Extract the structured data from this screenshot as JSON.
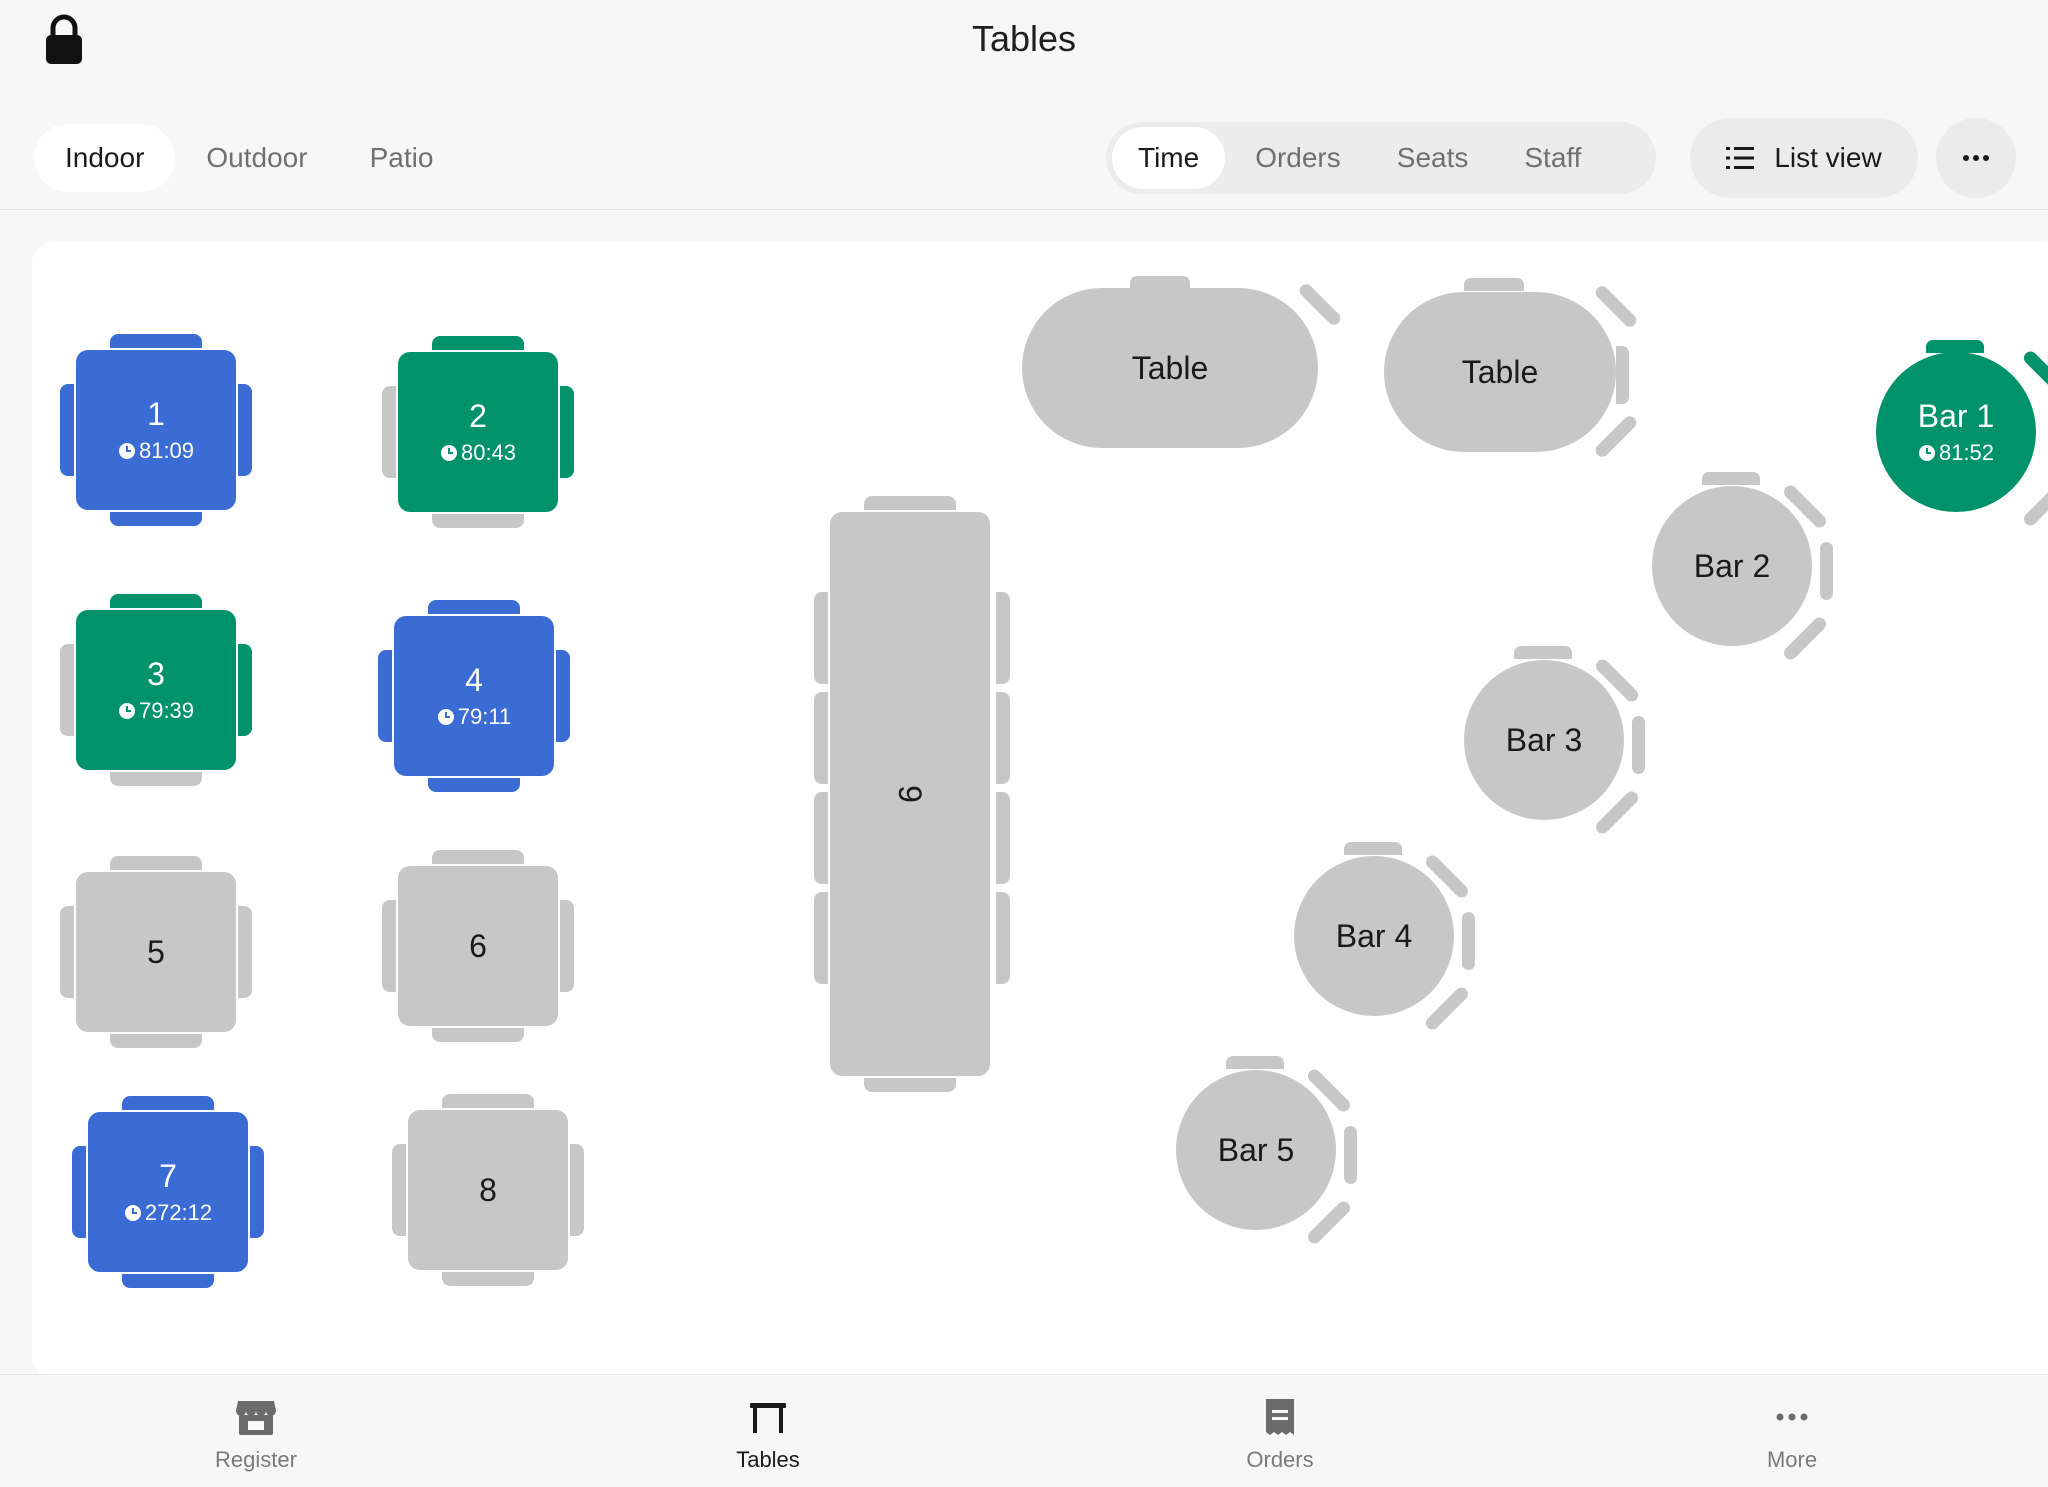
{
  "header": {
    "title": "Tables"
  },
  "area_tabs": [
    "Indoor",
    "Outdoor",
    "Patio"
  ],
  "active_area": "Indoor",
  "view_segments": [
    "Time",
    "Orders",
    "Seats",
    "Staff"
  ],
  "active_segment": "Time",
  "list_view_label": "List view",
  "colors": {
    "occupied_blue": "#3b6cd4",
    "occupied_green": "#00936b",
    "empty_gray": "#c7c7c7"
  },
  "tables": {
    "t1": {
      "label": "1",
      "time": "81:09"
    },
    "t2": {
      "label": "2",
      "time": "80:43"
    },
    "t3": {
      "label": "3",
      "time": "79:39"
    },
    "t4": {
      "label": "4",
      "time": "79:11"
    },
    "t5": {
      "label": "5"
    },
    "t6": {
      "label": "6"
    },
    "t7": {
      "label": "7",
      "time": "272:12"
    },
    "t8": {
      "label": "8"
    },
    "t9": {
      "label": "9"
    },
    "oval_a": {
      "label": "Table"
    },
    "oval_b": {
      "label": "Table"
    },
    "bar1": {
      "label": "Bar 1",
      "time": "81:52"
    },
    "bar2": {
      "label": "Bar 2"
    },
    "bar3": {
      "label": "Bar 3"
    },
    "bar4": {
      "label": "Bar 4"
    },
    "bar5": {
      "label": "Bar 5"
    }
  },
  "bottom_nav": [
    {
      "label": "Register",
      "icon": "storefront-icon"
    },
    {
      "label": "Tables",
      "icon": "table-icon"
    },
    {
      "label": "Orders",
      "icon": "receipt-icon"
    },
    {
      "label": "More",
      "icon": "more-dots-icon"
    }
  ],
  "active_nav": "Tables"
}
